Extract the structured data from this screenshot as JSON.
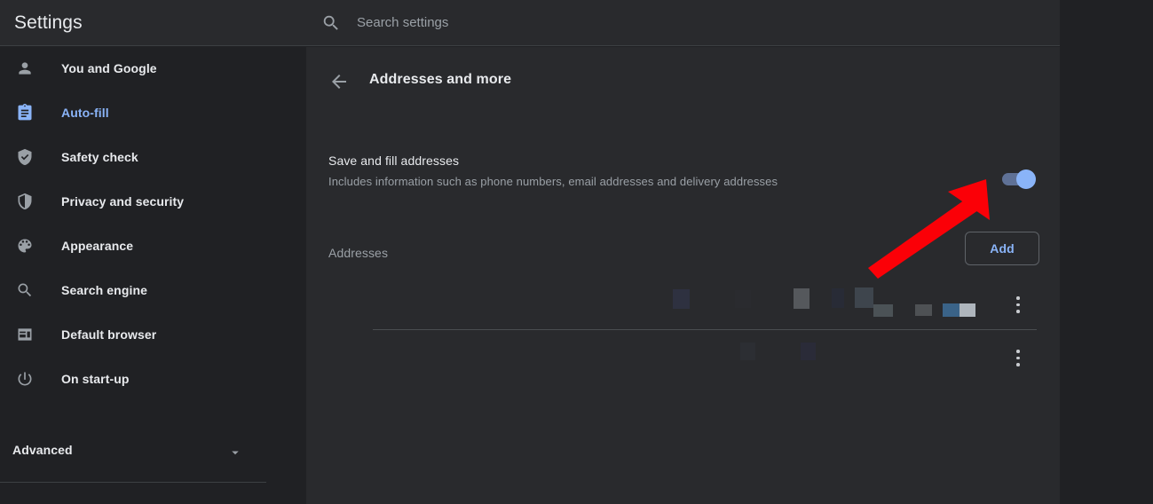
{
  "sidebar": {
    "title": "Settings",
    "items": [
      {
        "label": "You and Google",
        "icon": "person-icon",
        "active": false
      },
      {
        "label": "Auto-fill",
        "icon": "clipboard-icon",
        "active": true
      },
      {
        "label": "Safety check",
        "icon": "shield-check-icon",
        "active": false
      },
      {
        "label": "Privacy and security",
        "icon": "shield-half-icon",
        "active": false
      },
      {
        "label": "Appearance",
        "icon": "palette-icon",
        "active": false
      },
      {
        "label": "Search engine",
        "icon": "search-icon",
        "active": false
      },
      {
        "label": "Default browser",
        "icon": "browser-window-icon",
        "active": false
      },
      {
        "label": "On start-up",
        "icon": "power-icon",
        "active": false
      }
    ],
    "advanced": {
      "label": "Advanced",
      "icon": "chevron-down-icon"
    }
  },
  "search": {
    "placeholder": "Search settings",
    "value": "",
    "icon": "search-icon"
  },
  "main": {
    "back_icon": "arrow-left-icon",
    "title": "Addresses and more",
    "save_and_fill": {
      "title": "Save and fill addresses",
      "subtitle": "Includes information such as phone numbers, email addresses and delivery addresses",
      "toggle_state": "on"
    },
    "addresses_section": {
      "label": "Addresses",
      "add_label": "Add",
      "rows": [
        {
          "menu_icon": "more-vertical-icon",
          "redacted": true
        },
        {
          "menu_icon": "more-vertical-icon",
          "redacted": true
        }
      ]
    }
  },
  "annotation": {
    "type": "arrow",
    "color": "#fb0007",
    "points_to": "save-and-fill-toggle"
  },
  "colors": {
    "accent": "#8ab4f8",
    "card_bg": "#292a2d",
    "window_bg": "#202124",
    "text_primary": "#e8eaed",
    "text_secondary": "#9aa0a6",
    "divider": "#3c4043",
    "annotation_red": "#fb0007"
  }
}
